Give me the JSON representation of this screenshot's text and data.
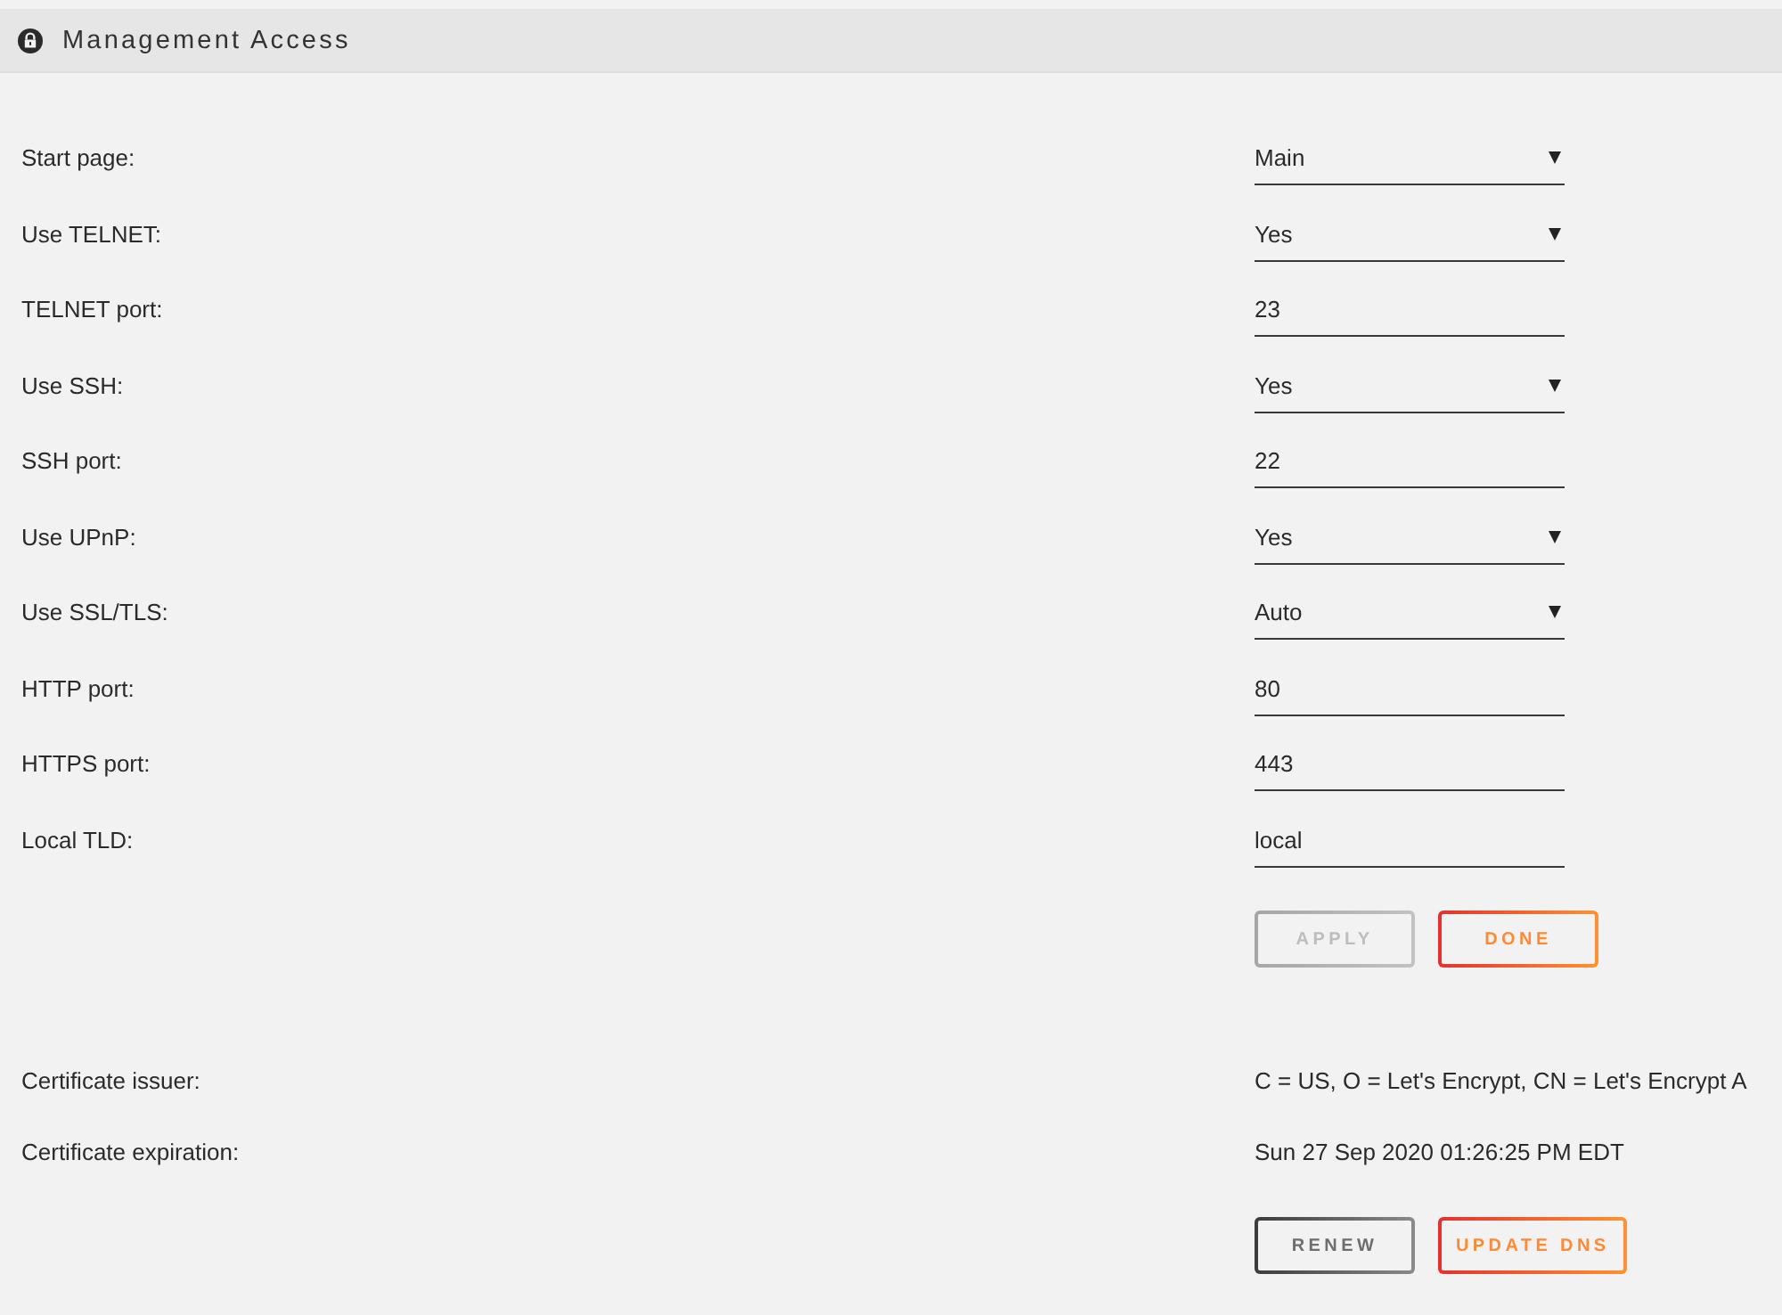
{
  "header": {
    "title": "Management Access"
  },
  "settings": [
    {
      "label": "Start page:",
      "kind": "select",
      "value": "Main"
    },
    {
      "label": "Use TELNET:",
      "kind": "select",
      "value": "Yes"
    },
    {
      "label": "TELNET port:",
      "kind": "input",
      "value": "23"
    },
    {
      "label": "Use SSH:",
      "kind": "select",
      "value": "Yes"
    },
    {
      "label": "SSH port:",
      "kind": "input",
      "value": "22"
    },
    {
      "label": "Use UPnP:",
      "kind": "select",
      "value": "Yes"
    },
    {
      "label": "Use SSL/TLS:",
      "kind": "select",
      "value": "Auto"
    },
    {
      "label": "HTTP port:",
      "kind": "input",
      "value": "80"
    },
    {
      "label": "HTTPS port:",
      "kind": "input",
      "value": "443"
    },
    {
      "label": "Local TLD:",
      "kind": "input",
      "value": "local"
    }
  ],
  "form_buttons": [
    {
      "label": "APPLY",
      "kind": "neutral",
      "disabled": true
    },
    {
      "label": "DONE",
      "kind": "accent",
      "disabled": false
    }
  ],
  "certificate": {
    "rows": [
      {
        "label": "Certificate issuer:",
        "value": "C = US, O = Let's Encrypt, CN = Let's Encrypt A"
      },
      {
        "label": "Certificate expiration:",
        "value": "Sun 27 Sep 2020 01:26:25 PM EDT"
      }
    ],
    "buttons": [
      {
        "label": "RENEW",
        "kind": "neutral",
        "disabled": false
      },
      {
        "label": "UPDATE DNS",
        "kind": "accent",
        "disabled": false
      }
    ]
  }
}
